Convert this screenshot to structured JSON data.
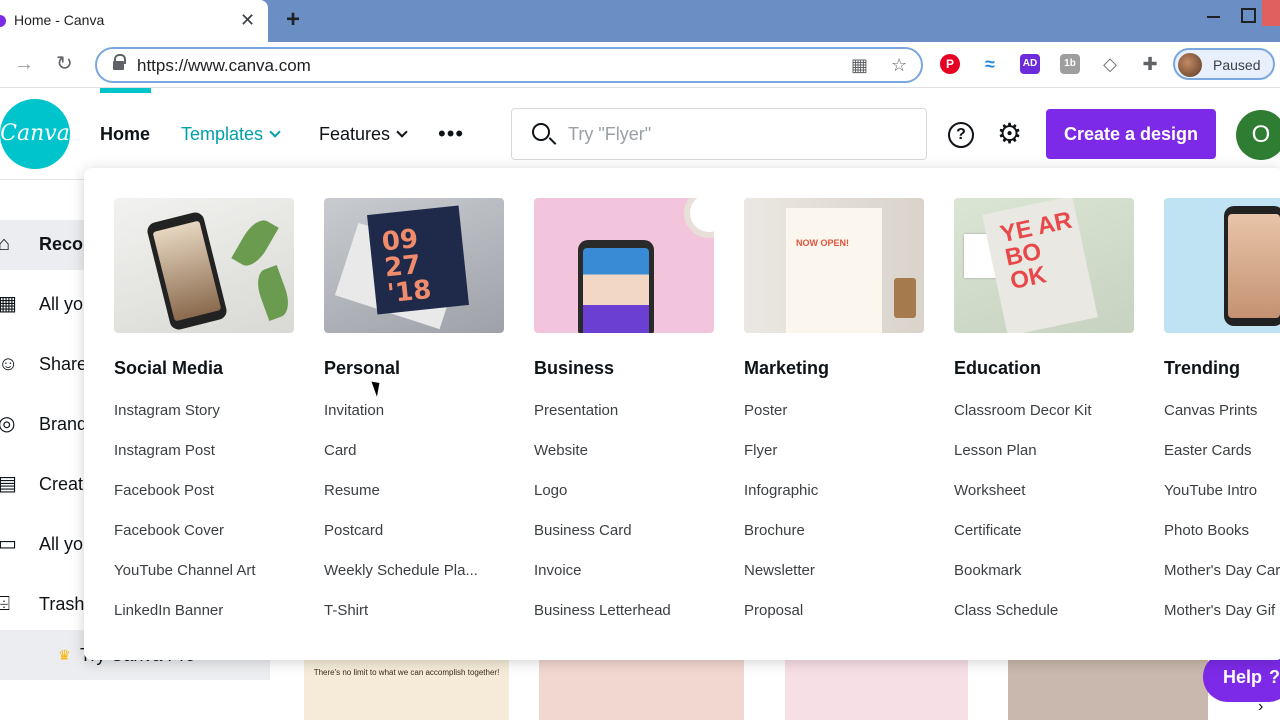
{
  "browser": {
    "tab_title": "Home - Canva",
    "tab_close": "✕",
    "new_tab": "+",
    "url": "https://www.canva.com",
    "profile_label": "Paused",
    "extensions": [
      "pinterest-icon",
      "wave-icon",
      "ad-icon",
      "tb-icon",
      "tag-icon",
      "puzzle-icon"
    ]
  },
  "header": {
    "logo_text": "Canva",
    "nav": {
      "home": "Home",
      "templates": "Templates",
      "features": "Features",
      "more": "•••"
    },
    "search_placeholder": "Try \"Flyer\"",
    "help": "?",
    "create_button": "Create a design",
    "avatar_initial": "O",
    "accent_color": "#7d2ae8",
    "brand_color": "#00c4cc"
  },
  "sidebar": {
    "items": [
      {
        "label": "Recon",
        "icon": "home-icon"
      },
      {
        "label": "All yo",
        "icon": "grid-icon"
      },
      {
        "label": "Share",
        "icon": "people-icon"
      },
      {
        "label": "Brand",
        "icon": "brand-kit-icon"
      },
      {
        "label": "Creat",
        "icon": "content-planner-icon"
      },
      {
        "label": "All yo",
        "icon": "folder-icon"
      },
      {
        "label": "Trash",
        "icon": "trash-icon"
      }
    ],
    "try_pro": "Try Canva Pro"
  },
  "background": {
    "thumb_1_text": "There's no limit to what we can accomplish together!"
  },
  "help_widget": {
    "label": "Help",
    "q": "?"
  },
  "dropdown": {
    "columns": [
      {
        "heading": "Social Media",
        "links": [
          "Instagram Story",
          "Instagram Post",
          "Facebook Post",
          "Facebook Cover",
          "YouTube Channel Art",
          "LinkedIn Banner"
        ]
      },
      {
        "heading": "Personal",
        "card_text": "09 27 '18",
        "links": [
          "Invitation",
          "Card",
          "Resume",
          "Postcard",
          "Weekly Schedule Pla...",
          "T-Shirt"
        ]
      },
      {
        "heading": "Business",
        "links": [
          "Presentation",
          "Website",
          "Logo",
          "Business Card",
          "Invoice",
          "Business Letterhead"
        ]
      },
      {
        "heading": "Marketing",
        "poster_text": "NOW OPEN!",
        "links": [
          "Poster",
          "Flyer",
          "Infographic",
          "Brochure",
          "Newsletter",
          "Proposal"
        ]
      },
      {
        "heading": "Education",
        "book_text": "YE AR BO OK",
        "links": [
          "Classroom Decor Kit",
          "Lesson Plan",
          "Worksheet",
          "Certificate",
          "Bookmark",
          "Class Schedule"
        ]
      },
      {
        "heading": "Trending",
        "links": [
          "Canvas Prints",
          "Easter Cards",
          "YouTube Intro",
          "Photo Books",
          "Mother's Day Car",
          "Mother's Day Gif"
        ]
      }
    ]
  }
}
